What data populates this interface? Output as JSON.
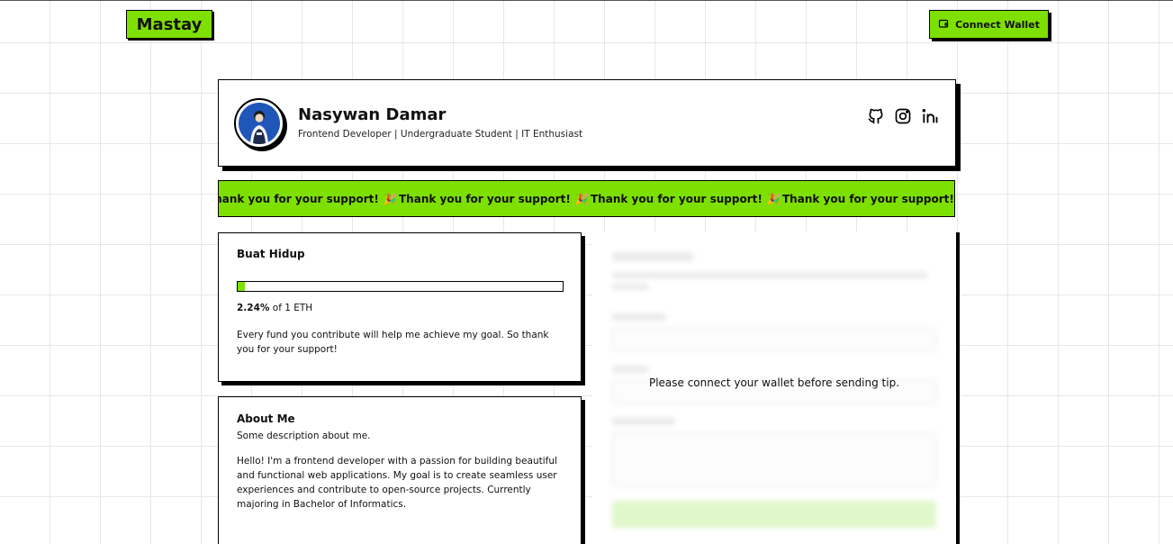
{
  "header": {
    "logo": "Mastay",
    "connect_label": "Connect Wallet"
  },
  "profile": {
    "name": "Nasywan Damar",
    "role": "Frontend Developer | Undergraduate Student | IT Enthusiast",
    "socials": [
      "github-icon",
      "instagram-icon",
      "linkedin-icon"
    ]
  },
  "marquee": {
    "items": [
      "Thank you for your support!",
      "Thank you for your support!",
      "Thank you for your support!",
      "Thank you for your support!"
    ],
    "emoji": "🎉"
  },
  "goal": {
    "title": "Buat Hidup",
    "percent_label": "2.24%",
    "target_label": "of 1 ETH",
    "progress_fraction": 0.0224,
    "description": "Every fund you contribute will help me achieve my goal. So thank you for your support!"
  },
  "about": {
    "title": "About Me",
    "subtitle": "Some description about me.",
    "body": "Hello! I'm a frontend developer with a passion for building beautiful and functional web applications. My goal is to create seamless user experiences and contribute to open-source projects. Currently majoring in Bachelor of Informatics."
  },
  "tip": {
    "message": "Please connect your wallet before sending tip."
  },
  "colors": {
    "accent": "#7ee000",
    "border": "#000000",
    "avatar_bg": "#1f56b8"
  }
}
